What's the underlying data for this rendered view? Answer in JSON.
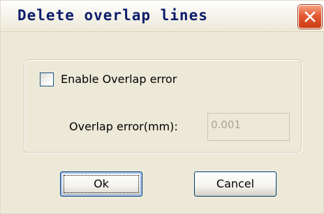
{
  "window": {
    "title": "Delete overlap lines",
    "close_icon": "close-x-icon"
  },
  "options": {
    "enable_label": "Enable Overlap error",
    "enable_checked": false,
    "error_label": "Overlap error(mm):",
    "error_value": "0.001"
  },
  "buttons": {
    "ok_label": "Ok",
    "cancel_label": "Cancel"
  },
  "colors": {
    "title_text": "#0b1d6b",
    "dialog_bg": "#ece9d8",
    "close_button": "#e45a33",
    "button_border": "#003c74"
  }
}
